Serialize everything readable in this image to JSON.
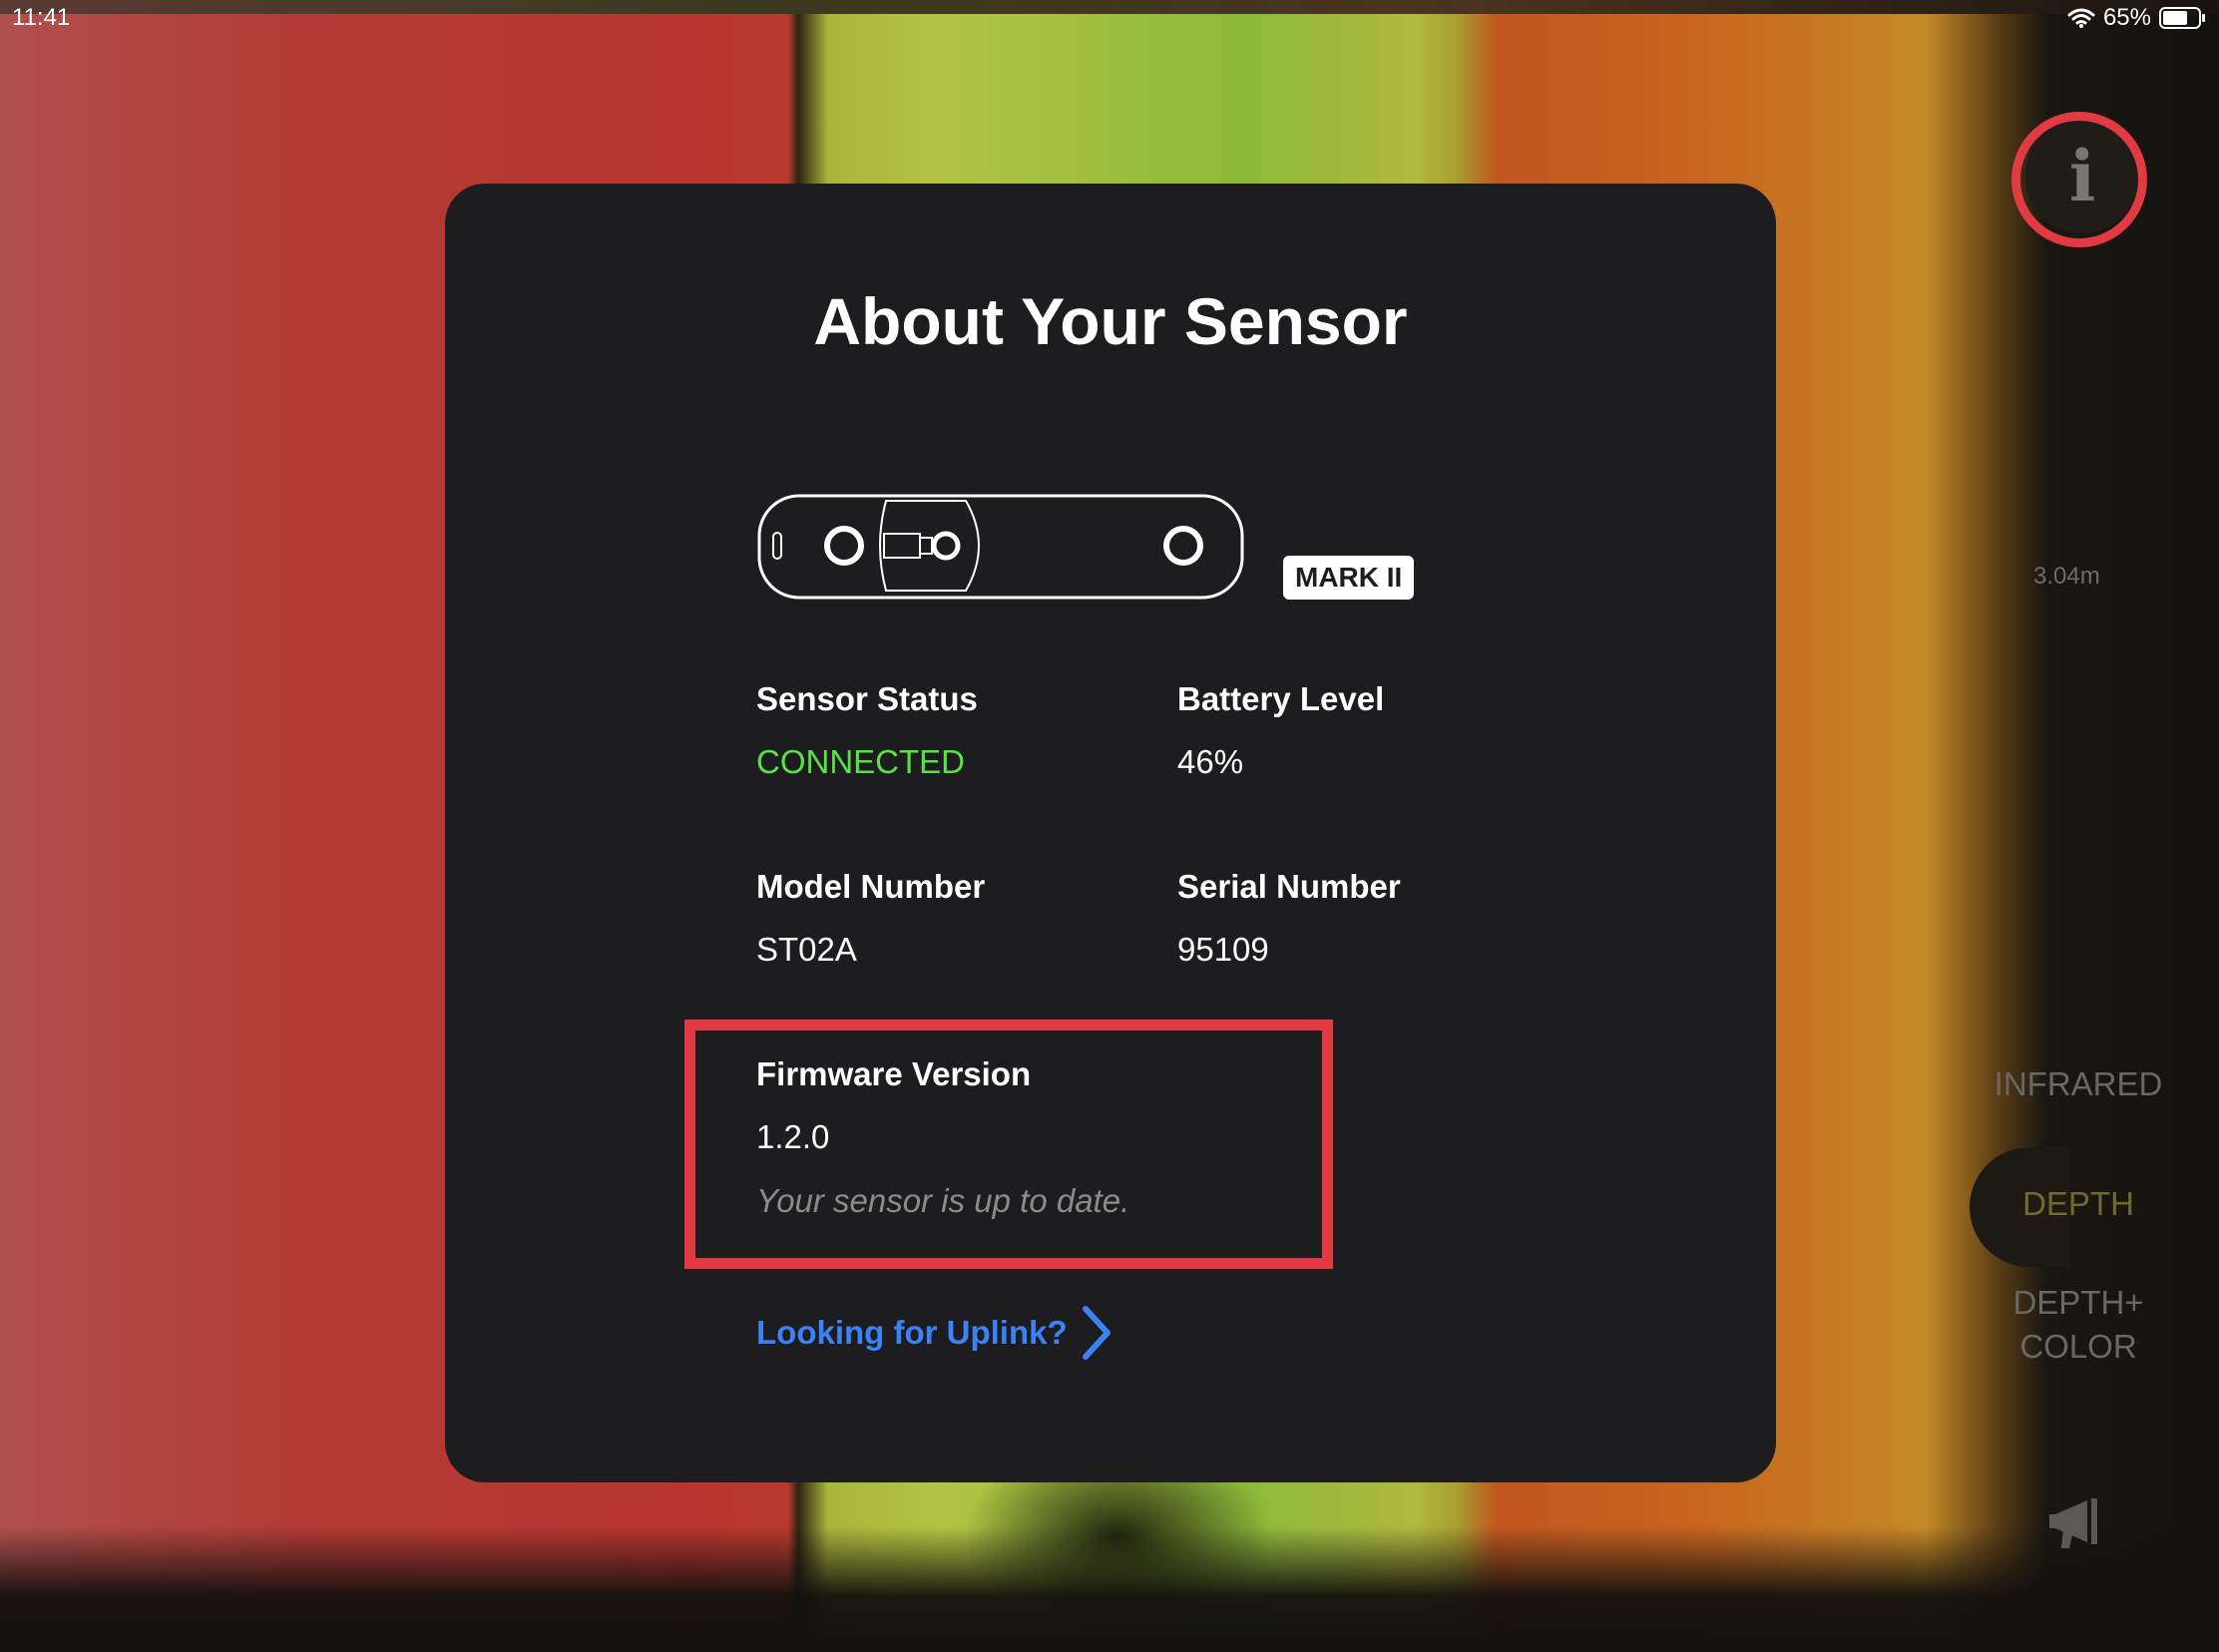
{
  "status_bar": {
    "time": "11:41",
    "battery_percent": "65%"
  },
  "right_rail": {
    "info_glyph": "i",
    "distance": "3.04m",
    "modes": {
      "infrared": "INFRARED",
      "depth": "DEPTH",
      "depth_color": "DEPTH+\nCOLOR"
    },
    "selected_mode": "DEPTH"
  },
  "modal": {
    "title": "About Your Sensor",
    "badge": "MARK II",
    "sensor_status": {
      "label": "Sensor Status",
      "value": "CONNECTED",
      "color": "#57e346"
    },
    "battery_level": {
      "label": "Battery Level",
      "value": "46%"
    },
    "model_number": {
      "label": "Model Number",
      "value": "ST02A"
    },
    "serial_number": {
      "label": "Serial Number",
      "value": "95109"
    },
    "firmware": {
      "label": "Firmware Version",
      "value": "1.2.0",
      "note": "Your sensor is up to date."
    },
    "uplink_link": "Looking for Uplink?"
  },
  "colors": {
    "highlight": "#e23a43",
    "link": "#3a82f7",
    "modal_bg": "#1d1d1f"
  },
  "icons": [
    "wifi-icon",
    "battery-icon",
    "info-icon",
    "sensor-device-icon",
    "chevron-right-icon",
    "megaphone-icon"
  ]
}
